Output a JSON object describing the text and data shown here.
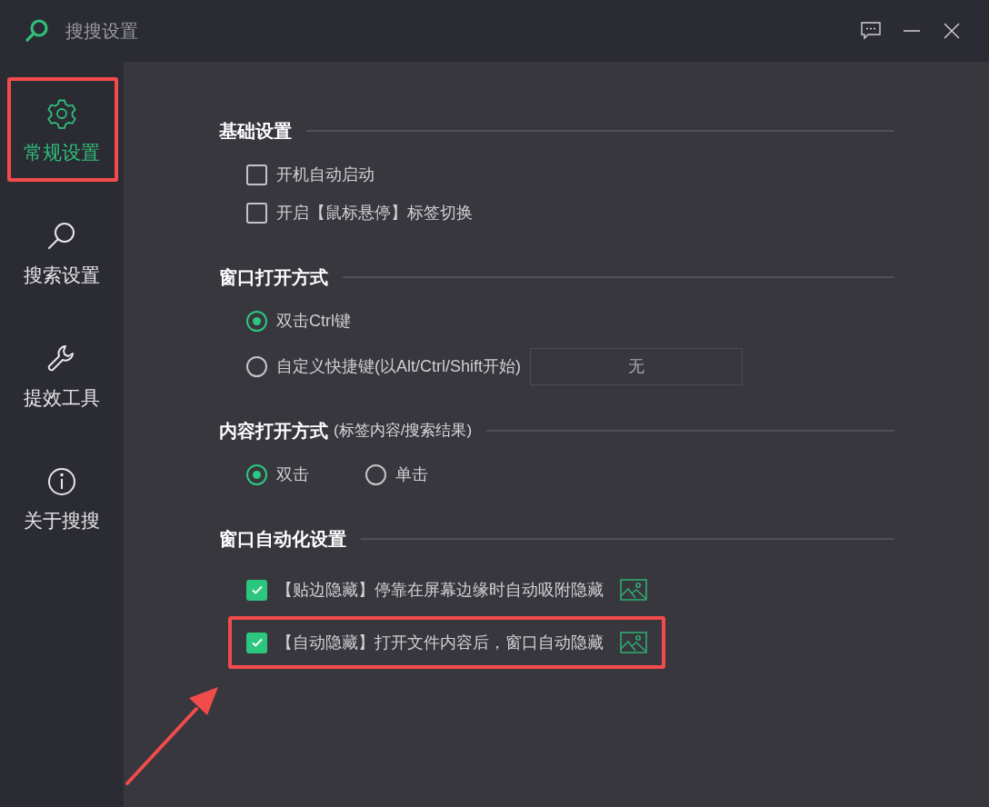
{
  "window": {
    "title": "搜搜设置"
  },
  "sidebar": {
    "items": [
      {
        "label": "常规设置",
        "selected": true,
        "highlighted": true
      },
      {
        "label": "搜索设置",
        "selected": false,
        "highlighted": false
      },
      {
        "label": "提效工具",
        "selected": false,
        "highlighted": false
      },
      {
        "label": "关于搜搜",
        "selected": false,
        "highlighted": false
      }
    ]
  },
  "sections": [
    {
      "title": "基础设置",
      "options": [
        {
          "kind": "checkbox",
          "label": "开机自动启动",
          "checked": false
        },
        {
          "kind": "checkbox",
          "label": "开启【鼠标悬停】标签切换",
          "checked": false
        }
      ]
    },
    {
      "title": "窗口打开方式",
      "options": [
        {
          "kind": "radio",
          "label": "双击Ctrl键",
          "selected": true
        },
        {
          "kind": "radio",
          "label": "自定义快捷键(以Alt/Ctrl/Shift开始)",
          "selected": false,
          "field": {
            "value": "无"
          }
        }
      ]
    },
    {
      "title": "内容打开方式",
      "subtitle": "(标签内容/搜索结果)",
      "inline": true,
      "options": [
        {
          "kind": "radio",
          "label": "双击",
          "selected": true
        },
        {
          "kind": "radio",
          "label": "单击",
          "selected": false
        }
      ]
    },
    {
      "title": "窗口自动化设置",
      "options": [
        {
          "kind": "checkbox",
          "label": "【贴边隐藏】停靠在屏幕边缘时自动吸附隐藏",
          "checked": true,
          "preview": true
        },
        {
          "kind": "checkbox",
          "label": "【自动隐藏】打开文件内容后，窗口自动隐藏",
          "checked": true,
          "preview": true,
          "highlighted": true
        }
      ]
    }
  ],
  "annotation_arrow": true
}
